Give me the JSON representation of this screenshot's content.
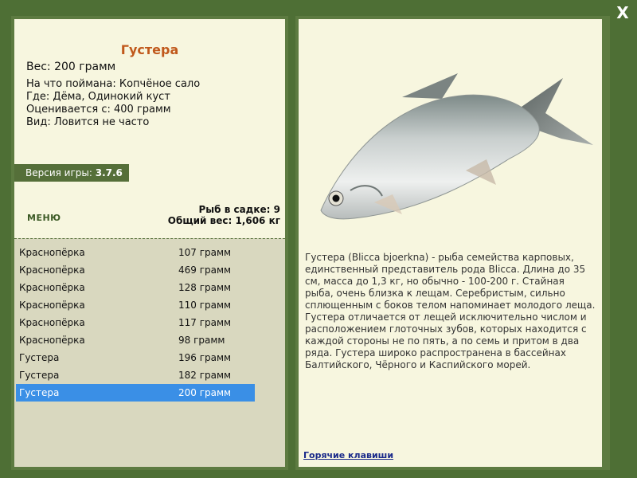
{
  "window": {
    "close_label": "X"
  },
  "fish": {
    "title": "Густера",
    "weight": "Вес: 200 грамм",
    "bait": "На что поймана: Копчёное сало",
    "place": "Где: Дёма, Одинокий куст",
    "value": "Оценивается с: 400 грамм",
    "rarity": "Вид: Ловится не часто"
  },
  "version": {
    "label": "Версия игры:",
    "number": "3.7.6"
  },
  "menu": {
    "label": "МЕНЮ"
  },
  "stats": {
    "count": "Рыб в садке: 9",
    "total": "Общий вес: 1,606 кг"
  },
  "catch_list": [
    {
      "name": "Краснопёрка",
      "weight": "107 грамм"
    },
    {
      "name": "Краснопёрка",
      "weight": "469 грамм"
    },
    {
      "name": "Краснопёрка",
      "weight": "128 грамм"
    },
    {
      "name": "Краснопёрка",
      "weight": "110 грамм"
    },
    {
      "name": "Краснопёрка",
      "weight": "117 грамм"
    },
    {
      "name": "Краснопёрка",
      "weight": "98 грамм"
    },
    {
      "name": "Густера",
      "weight": "196 грамм"
    },
    {
      "name": "Густера",
      "weight": "182 грамм"
    },
    {
      "name": "Густера",
      "weight": "200 грамм"
    }
  ],
  "description": "Густера (Blicca bjoerkna) - рыба семейства карповых, единственный представитель рода Blicca. Длина до 35 см, масса до 1,3 кг, но обычно - 100-200 г. Стайная рыба, очень близка к лещам. Серебристым, сильно сплющенным с боков телом напоминает молодого леща. Густера отличается от лещей исключительно числом и расположением глоточных зубов, которых находится с каждой стороны не по пять, а по семь и притом в два ряда. Густера широко распространена в бассейнах Балтийского, Чёрного и Каспийского морей.",
  "hotkeys": {
    "label": "Горячие клавиши"
  }
}
